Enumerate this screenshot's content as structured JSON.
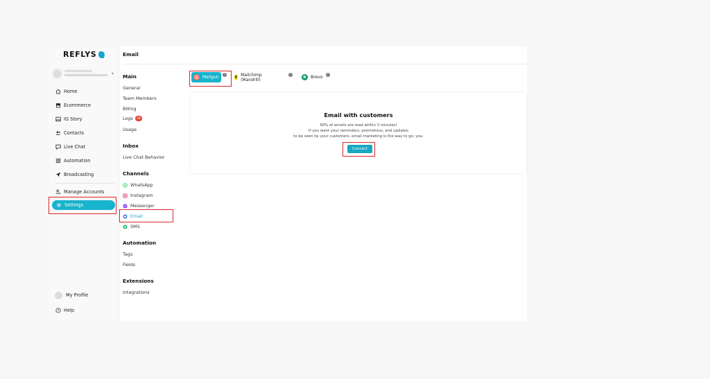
{
  "brand": {
    "name": "REFLYS",
    "accent": "#18b3cc",
    "highlight": "#d9262b"
  },
  "sidebar": {
    "items": [
      {
        "label": "Home",
        "icon": "home-icon"
      },
      {
        "label": "Ecommerce",
        "icon": "store-icon"
      },
      {
        "label": "IG Story",
        "icon": "image-icon"
      },
      {
        "label": "Contacts",
        "icon": "users-icon"
      },
      {
        "label": "Live Chat",
        "icon": "chat-icon"
      },
      {
        "label": "Automation",
        "icon": "automation-icon"
      },
      {
        "label": "Broadcasting",
        "icon": "send-icon"
      }
    ],
    "manage_accounts": "Manage Accounts",
    "settings": "Settings",
    "my_profile": "My Profile",
    "help": "Help"
  },
  "page": {
    "title": "Email"
  },
  "submenu": {
    "main": {
      "heading": "Main",
      "items": [
        "General",
        "Team Members",
        "Billing",
        "Logs",
        "Usage"
      ],
      "logs_badge": "38"
    },
    "inbox": {
      "heading": "Inbox",
      "items": [
        "Live Chat Behavior"
      ]
    },
    "channels": {
      "heading": "Channels",
      "items": [
        "WhatsApp",
        "Instagram",
        "Messenger",
        "Email",
        "SMS"
      ],
      "active": "Email"
    },
    "automation": {
      "heading": "Automation",
      "items": [
        "Tags",
        "Fields"
      ]
    },
    "extensions": {
      "heading": "Extensions",
      "items": [
        "Integrations"
      ]
    }
  },
  "providers": [
    {
      "label": "Mailgun",
      "icon_letter": "",
      "selected": true
    },
    {
      "label": "Mailchimp (Mandrill)",
      "icon_letter": "€"
    },
    {
      "label": "Brevo",
      "icon_letter": "B"
    }
  ],
  "card": {
    "title": "Email with customers",
    "line1": "90% of emails are read within 3 minutes!",
    "line2": "If you want your reminders, promotions, and updates",
    "line3": "to be seen by your customers, email marketing is the way to go, you.",
    "button": "Connect"
  }
}
